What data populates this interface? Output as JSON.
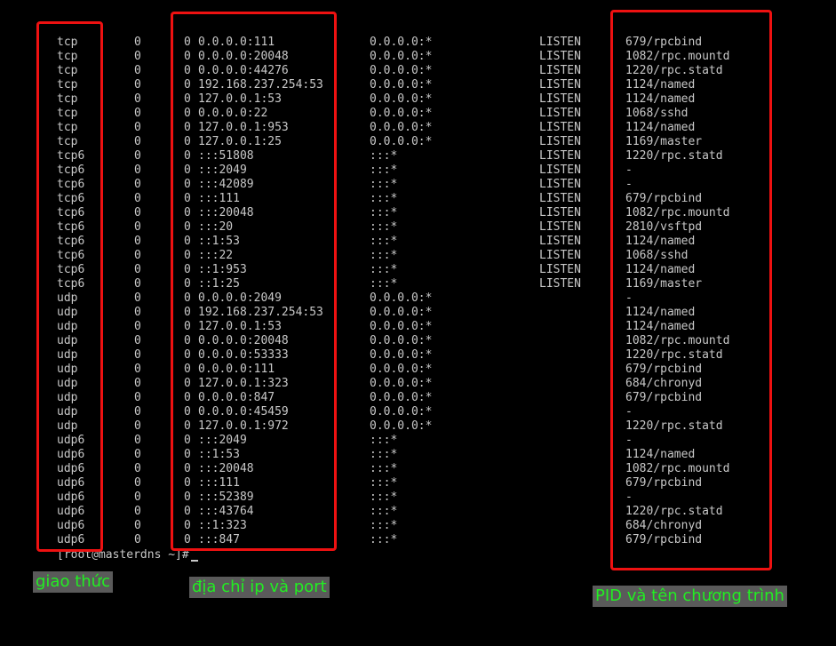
{
  "rows": [
    {
      "proto": "tcp",
      "recvq": "0",
      "sendq": "0",
      "local": "0.0.0.0:111",
      "foreign": "0.0.0.0:*",
      "state": "LISTEN",
      "pid": "679/rpcbind"
    },
    {
      "proto": "tcp",
      "recvq": "0",
      "sendq": "0",
      "local": "0.0.0.0:20048",
      "foreign": "0.0.0.0:*",
      "state": "LISTEN",
      "pid": "1082/rpc.mountd"
    },
    {
      "proto": "tcp",
      "recvq": "0",
      "sendq": "0",
      "local": "0.0.0.0:44276",
      "foreign": "0.0.0.0:*",
      "state": "LISTEN",
      "pid": "1220/rpc.statd"
    },
    {
      "proto": "tcp",
      "recvq": "0",
      "sendq": "0",
      "local": "192.168.237.254:53",
      "foreign": "0.0.0.0:*",
      "state": "LISTEN",
      "pid": "1124/named"
    },
    {
      "proto": "tcp",
      "recvq": "0",
      "sendq": "0",
      "local": "127.0.0.1:53",
      "foreign": "0.0.0.0:*",
      "state": "LISTEN",
      "pid": "1124/named"
    },
    {
      "proto": "tcp",
      "recvq": "0",
      "sendq": "0",
      "local": "0.0.0.0:22",
      "foreign": "0.0.0.0:*",
      "state": "LISTEN",
      "pid": "1068/sshd"
    },
    {
      "proto": "tcp",
      "recvq": "0",
      "sendq": "0",
      "local": "127.0.0.1:953",
      "foreign": "0.0.0.0:*",
      "state": "LISTEN",
      "pid": "1124/named"
    },
    {
      "proto": "tcp",
      "recvq": "0",
      "sendq": "0",
      "local": "127.0.0.1:25",
      "foreign": "0.0.0.0:*",
      "state": "LISTEN",
      "pid": "1169/master"
    },
    {
      "proto": "tcp6",
      "recvq": "0",
      "sendq": "0",
      "local": ":::51808",
      "foreign": ":::*",
      "state": "LISTEN",
      "pid": "1220/rpc.statd"
    },
    {
      "proto": "tcp6",
      "recvq": "0",
      "sendq": "0",
      "local": ":::2049",
      "foreign": ":::*",
      "state": "LISTEN",
      "pid": "-"
    },
    {
      "proto": "tcp6",
      "recvq": "0",
      "sendq": "0",
      "local": ":::42089",
      "foreign": ":::*",
      "state": "LISTEN",
      "pid": "-"
    },
    {
      "proto": "tcp6",
      "recvq": "0",
      "sendq": "0",
      "local": ":::111",
      "foreign": ":::*",
      "state": "LISTEN",
      "pid": "679/rpcbind"
    },
    {
      "proto": "tcp6",
      "recvq": "0",
      "sendq": "0",
      "local": ":::20048",
      "foreign": ":::*",
      "state": "LISTEN",
      "pid": "1082/rpc.mountd"
    },
    {
      "proto": "tcp6",
      "recvq": "0",
      "sendq": "0",
      "local": ":::20",
      "foreign": ":::*",
      "state": "LISTEN",
      "pid": "2810/vsftpd"
    },
    {
      "proto": "tcp6",
      "recvq": "0",
      "sendq": "0",
      "local": "::1:53",
      "foreign": ":::*",
      "state": "LISTEN",
      "pid": "1124/named"
    },
    {
      "proto": "tcp6",
      "recvq": "0",
      "sendq": "0",
      "local": ":::22",
      "foreign": ":::*",
      "state": "LISTEN",
      "pid": "1068/sshd"
    },
    {
      "proto": "tcp6",
      "recvq": "0",
      "sendq": "0",
      "local": "::1:953",
      "foreign": ":::*",
      "state": "LISTEN",
      "pid": "1124/named"
    },
    {
      "proto": "tcp6",
      "recvq": "0",
      "sendq": "0",
      "local": "::1:25",
      "foreign": ":::*",
      "state": "LISTEN",
      "pid": "1169/master"
    },
    {
      "proto": "udp",
      "recvq": "0",
      "sendq": "0",
      "local": "0.0.0.0:2049",
      "foreign": "0.0.0.0:*",
      "state": "",
      "pid": "-"
    },
    {
      "proto": "udp",
      "recvq": "0",
      "sendq": "0",
      "local": "192.168.237.254:53",
      "foreign": "0.0.0.0:*",
      "state": "",
      "pid": "1124/named"
    },
    {
      "proto": "udp",
      "recvq": "0",
      "sendq": "0",
      "local": "127.0.0.1:53",
      "foreign": "0.0.0.0:*",
      "state": "",
      "pid": "1124/named"
    },
    {
      "proto": "udp",
      "recvq": "0",
      "sendq": "0",
      "local": "0.0.0.0:20048",
      "foreign": "0.0.0.0:*",
      "state": "",
      "pid": "1082/rpc.mountd"
    },
    {
      "proto": "udp",
      "recvq": "0",
      "sendq": "0",
      "local": "0.0.0.0:53333",
      "foreign": "0.0.0.0:*",
      "state": "",
      "pid": "1220/rpc.statd"
    },
    {
      "proto": "udp",
      "recvq": "0",
      "sendq": "0",
      "local": "0.0.0.0:111",
      "foreign": "0.0.0.0:*",
      "state": "",
      "pid": "679/rpcbind"
    },
    {
      "proto": "udp",
      "recvq": "0",
      "sendq": "0",
      "local": "127.0.0.1:323",
      "foreign": "0.0.0.0:*",
      "state": "",
      "pid": "684/chronyd"
    },
    {
      "proto": "udp",
      "recvq": "0",
      "sendq": "0",
      "local": "0.0.0.0:847",
      "foreign": "0.0.0.0:*",
      "state": "",
      "pid": "679/rpcbind"
    },
    {
      "proto": "udp",
      "recvq": "0",
      "sendq": "0",
      "local": "0.0.0.0:45459",
      "foreign": "0.0.0.0:*",
      "state": "",
      "pid": "-"
    },
    {
      "proto": "udp",
      "recvq": "0",
      "sendq": "0",
      "local": "127.0.0.1:972",
      "foreign": "0.0.0.0:*",
      "state": "",
      "pid": "1220/rpc.statd"
    },
    {
      "proto": "udp6",
      "recvq": "0",
      "sendq": "0",
      "local": ":::2049",
      "foreign": ":::*",
      "state": "",
      "pid": "-"
    },
    {
      "proto": "udp6",
      "recvq": "0",
      "sendq": "0",
      "local": "::1:53",
      "foreign": ":::*",
      "state": "",
      "pid": "1124/named"
    },
    {
      "proto": "udp6",
      "recvq": "0",
      "sendq": "0",
      "local": ":::20048",
      "foreign": ":::*",
      "state": "",
      "pid": "1082/rpc.mountd"
    },
    {
      "proto": "udp6",
      "recvq": "0",
      "sendq": "0",
      "local": ":::111",
      "foreign": ":::*",
      "state": "",
      "pid": "679/rpcbind"
    },
    {
      "proto": "udp6",
      "recvq": "0",
      "sendq": "0",
      "local": ":::52389",
      "foreign": ":::*",
      "state": "",
      "pid": "-"
    },
    {
      "proto": "udp6",
      "recvq": "0",
      "sendq": "0",
      "local": ":::43764",
      "foreign": ":::*",
      "state": "",
      "pid": "1220/rpc.statd"
    },
    {
      "proto": "udp6",
      "recvq": "0",
      "sendq": "0",
      "local": "::1:323",
      "foreign": ":::*",
      "state": "",
      "pid": "684/chronyd"
    },
    {
      "proto": "udp6",
      "recvq": "0",
      "sendq": "0",
      "local": ":::847",
      "foreign": ":::*",
      "state": "",
      "pid": "679/rpcbind"
    }
  ],
  "prompt": "[root@masterdns ~]#",
  "annotations": {
    "protocol_label": "giao thức",
    "address_label": "địa chỉ ip và port",
    "pid_label": "PID và tên chương trình"
  },
  "colors": {
    "terminal_bg": "#000000",
    "terminal_text": "#c8c8c8",
    "highlight_box": "#ee1111",
    "label_text": "#22ee22",
    "label_bg": "#5a5a5a"
  }
}
